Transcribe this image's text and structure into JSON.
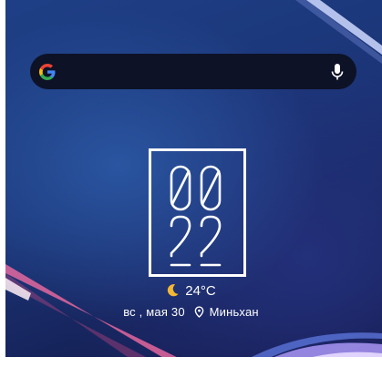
{
  "search": {
    "google_icon": "google-g-icon",
    "mic_icon": "microphone-icon"
  },
  "clock": {
    "hours": "00",
    "minutes": "22"
  },
  "weather": {
    "icon": "crescent-moon-icon",
    "temperature": "24°C"
  },
  "date_location": {
    "date": "вс , мая 30",
    "location_icon": "location-pin-icon",
    "location": "Миньхан"
  },
  "colors": {
    "search_bg": "#0d1226",
    "moon": "#f5b731",
    "text": "#ffffff"
  }
}
